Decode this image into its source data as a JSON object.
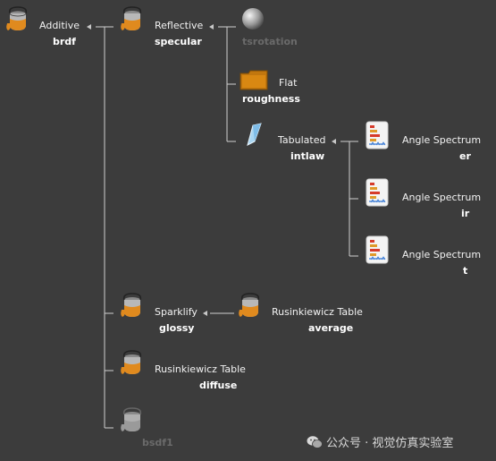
{
  "nodes": {
    "brdf": {
      "type": "Additive",
      "name": "brdf",
      "icon": "paint-bucket-icon"
    },
    "specular": {
      "type": "Reflective",
      "name": "specular",
      "icon": "paint-bucket-icon"
    },
    "tsrotation": {
      "type": "",
      "name": "tsrotation",
      "icon": "gray-sphere-icon",
      "state": "disabled"
    },
    "roughness": {
      "type": "Flat",
      "name": "roughness",
      "icon": "orange-swatch-icon"
    },
    "intlaw": {
      "type": "Tabulated",
      "name": "intlaw",
      "icon": "blue-plane-icon"
    },
    "er": {
      "type": "Angle Spectrum",
      "name": "er",
      "icon": "spectrum-chart-icon"
    },
    "ir": {
      "type": "Angle Spectrum",
      "name": "ir",
      "icon": "spectrum-chart-icon"
    },
    "t": {
      "type": "Angle Spectrum",
      "name": "t",
      "icon": "spectrum-chart-icon"
    },
    "glossy": {
      "type": "Sparklify",
      "name": "glossy",
      "icon": "paint-bucket-icon"
    },
    "average": {
      "type": "Rusinkiewicz Table",
      "name": "average",
      "icon": "paint-bucket-icon"
    },
    "diffuse": {
      "type": "Rusinkiewicz Table",
      "name": "diffuse",
      "icon": "paint-bucket-icon"
    },
    "bsdf1": {
      "type": "",
      "name": "bsdf1",
      "icon": "gray-bucket-icon",
      "state": "disabled"
    }
  },
  "watermark": {
    "text": "公众号 · 视觉仿真实验室",
    "icon": "wechat-icon"
  },
  "colors": {
    "background": "#3c3c3c",
    "connector": "#cfcfcf",
    "disabled_text": "#6a6a6a",
    "bucket_orange": "#e08a1e"
  }
}
